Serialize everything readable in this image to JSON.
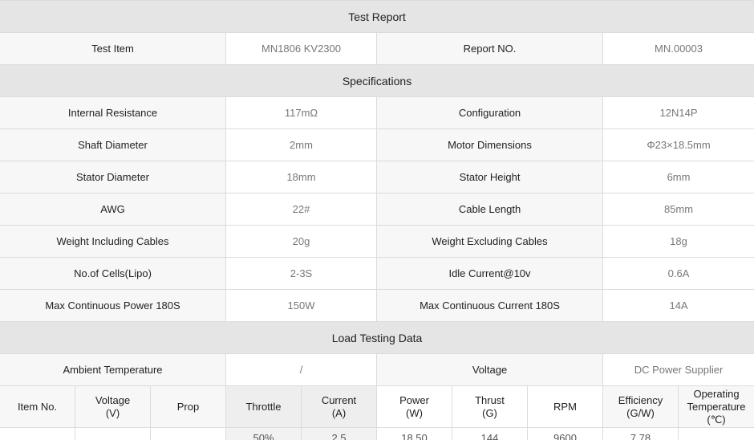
{
  "title": "Test Report",
  "test_item_label": "Test Item",
  "test_item_value": "MN1806 KV2300",
  "report_no_label": "Report NO.",
  "report_no_value": "MN.00003",
  "specifications_title": "Specifications",
  "specs": [
    {
      "label1": "Internal Resistance",
      "value1": "117mΩ",
      "label2": "Configuration",
      "value2": "12N14P"
    },
    {
      "label1": "Shaft Diameter",
      "value1": "2mm",
      "label2": "Motor Dimensions",
      "value2": "Φ23×18.5mm"
    },
    {
      "label1": "Stator Diameter",
      "value1": "18mm",
      "label2": "Stator Height",
      "value2": "6mm"
    },
    {
      "label1": "AWG",
      "value1": "22#",
      "label2": "Cable Length",
      "value2": "85mm"
    },
    {
      "label1": "Weight Including Cables",
      "value1": "20g",
      "label2": "Weight Excluding Cables",
      "value2": "18g"
    },
    {
      "label1": "No.of Cells(Lipo)",
      "value1": "2-3S",
      "label2": "Idle Current@10v",
      "value2": "0.6A"
    },
    {
      "label1": "Max Continuous Power 180S",
      "value1": "150W",
      "label2": "Max Continuous Current 180S",
      "value2": "14A"
    }
  ],
  "load_title": "Load Testing Data",
  "ambient_label": "Ambient Temperature",
  "ambient_value": "/",
  "voltage_label": "Voltage",
  "voltage_value": "DC Power Supplier",
  "headers": {
    "item_no": "Item No.",
    "voltage_l1": "Voltage",
    "voltage_l2": "(V)",
    "prop": "Prop",
    "throttle": "Throttle",
    "current_l1": "Current",
    "current_l2": "(A)",
    "power_l1": "Power",
    "power_l2": "(W)",
    "thrust_l1": "Thrust",
    "thrust_l2": "(G)",
    "rpm": "RPM",
    "eff_l1": "Efficiency",
    "eff_l2": "(G/W)",
    "temp_l1": "Operating",
    "temp_l2": "Temperature",
    "temp_l3": "(℃)"
  },
  "data_rows": [
    {
      "item_no": "",
      "voltage": "",
      "prop": "",
      "throttle": "50%",
      "current": "2.5",
      "power": "18.50",
      "thrust": "144",
      "rpm": "9600",
      "efficiency": "7.78",
      "temperature": ""
    }
  ]
}
